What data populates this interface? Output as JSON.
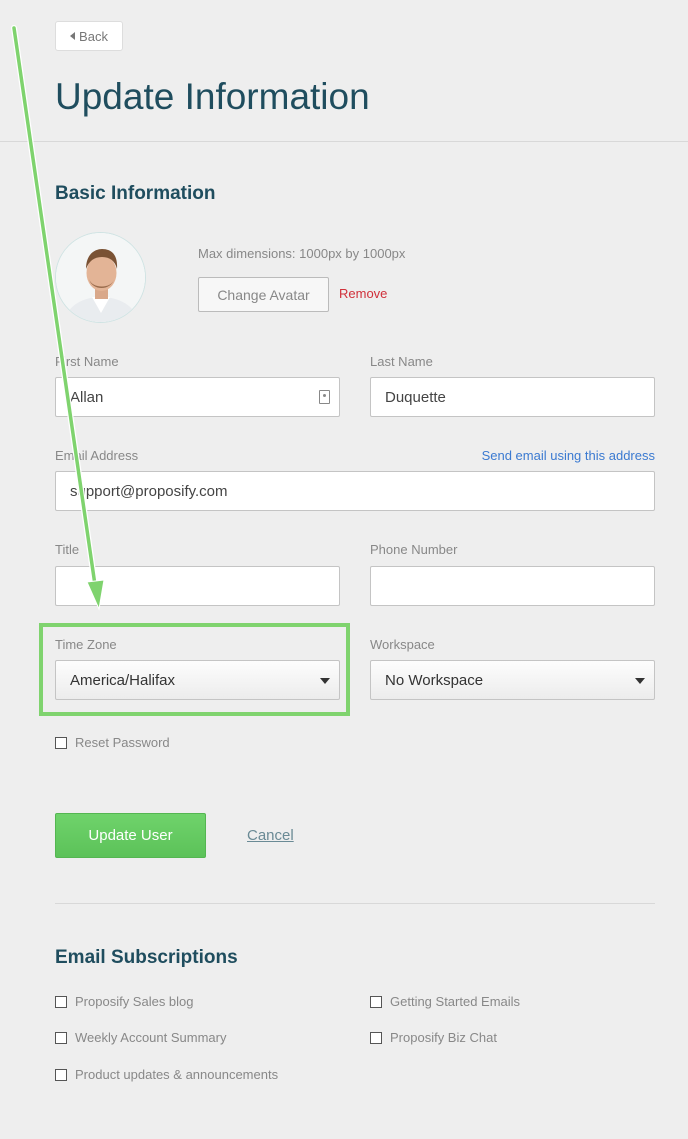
{
  "header": {
    "back_label": "Back",
    "page_title": "Update Information"
  },
  "basic_info": {
    "section_title": "Basic Information",
    "avatar": {
      "note": "Max dimensions: 1000px by 1000px",
      "change_label": "Change Avatar",
      "remove_label": "Remove"
    },
    "first_name": {
      "label": "First Name",
      "value": "Allan"
    },
    "last_name": {
      "label": "Last Name",
      "value": "Duquette"
    },
    "email": {
      "label": "Email Address",
      "value": "support@proposify.com",
      "send_link": "Send email using this address"
    },
    "title": {
      "label": "Title",
      "value": ""
    },
    "phone": {
      "label": "Phone Number",
      "value": ""
    },
    "time_zone": {
      "label": "Time Zone",
      "selected": "America/Halifax"
    },
    "workspace": {
      "label": "Workspace",
      "selected": "No Workspace"
    },
    "reset_password": {
      "label": "Reset Password",
      "checked": false
    }
  },
  "actions": {
    "update_label": "Update User",
    "cancel_label": "Cancel"
  },
  "subscriptions": {
    "section_title": "Email Subscriptions",
    "items": [
      {
        "label": "Proposify Sales blog",
        "checked": false
      },
      {
        "label": "Getting Started Emails",
        "checked": false
      },
      {
        "label": "Weekly Account Summary",
        "checked": false
      },
      {
        "label": "Proposify Biz Chat",
        "checked": false
      },
      {
        "label": "Product updates & announcements",
        "checked": false
      }
    ]
  },
  "colors": {
    "title": "#1f4d5e",
    "accent_green": "#5cc259",
    "highlight": "#7fd36e",
    "remove_red": "#d0303a",
    "link_blue": "#3b7ad1"
  }
}
